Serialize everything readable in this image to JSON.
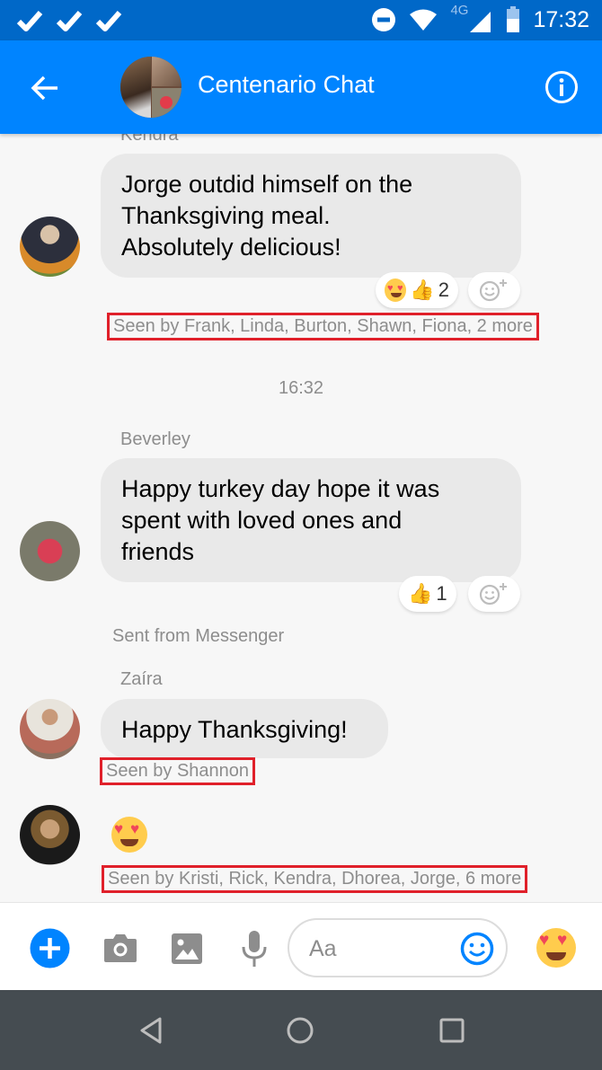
{
  "status_bar": {
    "notification_icons": [
      "check-icon",
      "check-icon",
      "check-icon"
    ],
    "status_icons": [
      "do-not-disturb-icon",
      "wifi-icon",
      "4g-icon",
      "signal-icon",
      "battery-icon"
    ],
    "network_label": "4G",
    "time": "17:32"
  },
  "header": {
    "back_icon": "arrow-left-icon",
    "title": "Centenario Chat",
    "info_icon": "info-icon"
  },
  "messages": [
    {
      "sender": "Kendra",
      "text_lines": [
        "Jorge outdid himself on the",
        "Thanksgiving meal.",
        "Absolutely delicious!"
      ],
      "reactions": {
        "emojis": [
          "heart-eyes-emoji",
          "thumbs-up-emoji"
        ],
        "count": "2"
      },
      "seen_by": "Seen by Frank, Linda, Burton, Shawn, Fiona, 2 more"
    },
    {
      "timestamp": "16:32",
      "sender": "Beverley",
      "text_lines": [
        "Happy turkey day hope it was",
        "spent with loved ones and",
        "friends"
      ],
      "reactions": {
        "emojis": [
          "thumbs-up-emoji"
        ],
        "count": "1"
      },
      "footer": "Sent from Messenger"
    },
    {
      "sender": "Zaíra",
      "text_lines": [
        "Happy Thanksgiving!"
      ],
      "seen_by": "Seen by Shannon"
    },
    {
      "sender": "",
      "emoji": "heart-eyes-emoji",
      "seen_by": "Seen by Kristi, Rick, Kendra, Dhorea, Jorge, 6 more"
    }
  ],
  "composer": {
    "placeholder": "Aa",
    "icons": [
      "plus-icon",
      "camera-icon",
      "image-icon",
      "microphone-icon",
      "smiley-icon",
      "heart-eyes-emoji"
    ]
  },
  "colors": {
    "brand_blue": "#0084ff",
    "status_bar_blue": "#0068c8",
    "seen_highlight": "#e0202a",
    "navbar": "#454c51"
  }
}
